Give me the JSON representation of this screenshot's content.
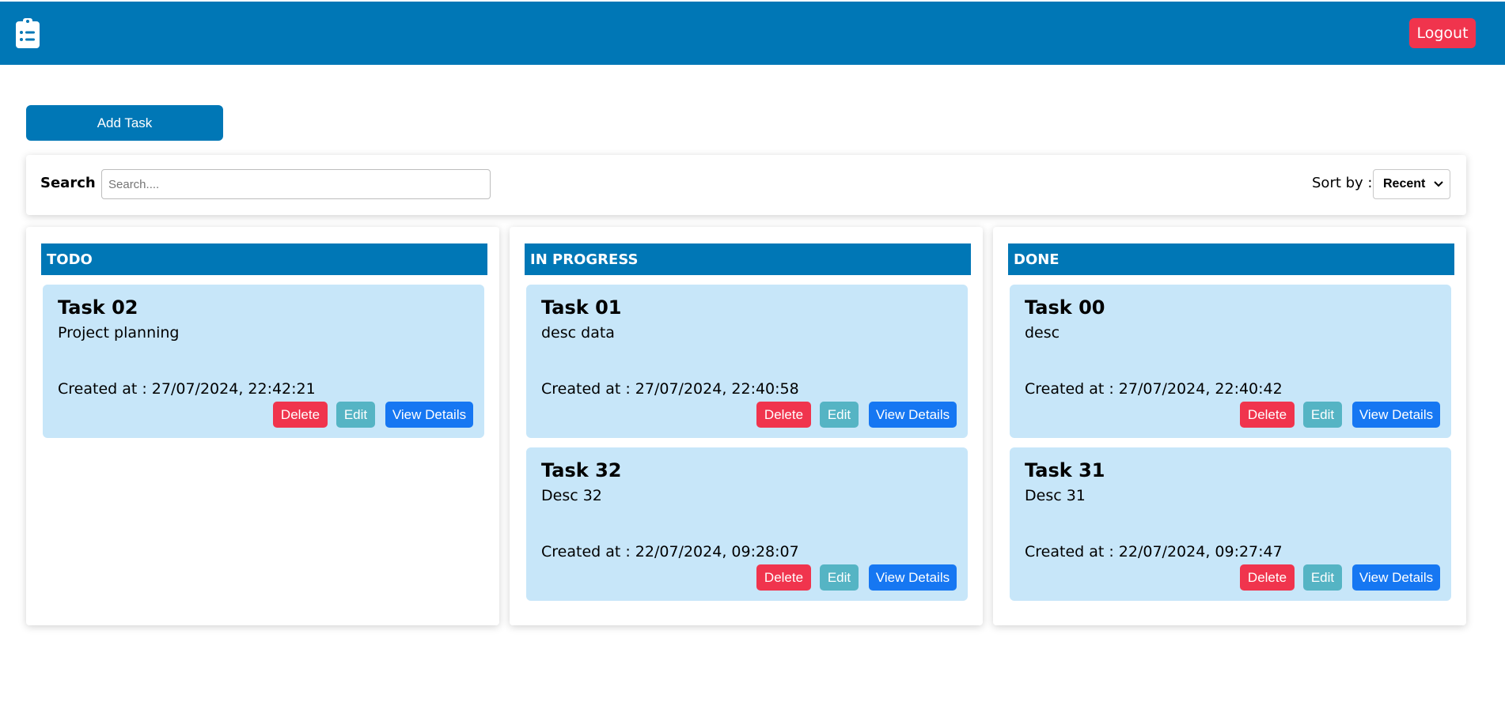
{
  "header": {
    "logo_icon": "clipboard-list-icon",
    "logout_label": "Logout"
  },
  "toolbar": {
    "add_task_label": "Add Task"
  },
  "filters": {
    "search_label": "Search :",
    "search_placeholder": "Search....",
    "search_value": "",
    "sort_label": "Sort by :",
    "sort_value": "Recent"
  },
  "columns": [
    {
      "title": "TODO",
      "cards": [
        {
          "title": "Task 02",
          "desc": "Project planning",
          "created": "Created at : 27/07/2024, 22:42:21"
        }
      ]
    },
    {
      "title": "IN PROGRESS",
      "cards": [
        {
          "title": "Task 01",
          "desc": "desc data",
          "created": "Created at : 27/07/2024, 22:40:58"
        },
        {
          "title": "Task 32",
          "desc": "Desc 32",
          "created": "Created at : 22/07/2024, 09:28:07"
        }
      ]
    },
    {
      "title": "DONE",
      "cards": [
        {
          "title": "Task 00",
          "desc": "desc",
          "created": "Created at : 27/07/2024, 22:40:42"
        },
        {
          "title": "Task 31",
          "desc": "Desc 31",
          "created": "Created at : 22/07/2024, 09:27:47"
        }
      ]
    }
  ],
  "card_actions": {
    "delete_label": "Delete",
    "edit_label": "Edit",
    "view_label": "View Details"
  },
  "colors": {
    "primary": "#0077b6",
    "danger": "#f0344d",
    "edit": "#55b4c4",
    "view": "#1677f2",
    "card_bg": "#c7e6f9"
  }
}
